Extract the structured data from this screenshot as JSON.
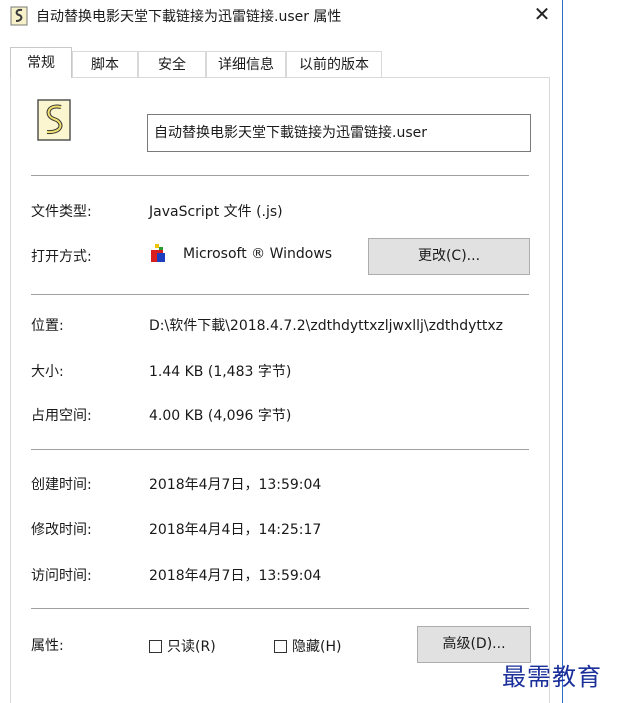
{
  "window": {
    "title": "自动替换电影天堂下載链接为迅雷链接.user 属性",
    "close_glyph": "✕"
  },
  "tabs": [
    {
      "label": "常规",
      "active": true
    },
    {
      "label": "脚本",
      "active": false
    },
    {
      "label": "安全",
      "active": false
    },
    {
      "label": "详细信息",
      "active": false
    },
    {
      "label": "以前的版本",
      "active": false
    }
  ],
  "general": {
    "file_name": "自动替换电影天堂下載链接为迅雷链接.user",
    "file_type_label": "文件类型:",
    "file_type_value": "JavaScript 文件 (.js)",
    "open_with_label": "打开方式:",
    "open_with_value": "Microsoft ® Windows",
    "change_button": "更改(C)...",
    "location_label": "位置:",
    "location_value": "D:\\软件下載\\2018.4.7.2\\zdthdyttxzljwxllj\\zdthdyttxz",
    "size_label": "大小:",
    "size_value": "1.44 KB (1,483 字节)",
    "size_on_disk_label": "占用空间:",
    "size_on_disk_value": "4.00 KB (4,096 字节)",
    "created_label": "创建时间:",
    "created_value": "2018年4月7日，13:59:04",
    "modified_label": "修改时间:",
    "modified_value": "2018年4月4日，14:25:17",
    "accessed_label": "访问时间:",
    "accessed_value": "2018年4月7日，13:59:04",
    "attributes_label": "属性:",
    "readonly_label": "只读(R)",
    "readonly_checked": false,
    "hidden_label": "隐藏(H)",
    "hidden_checked": false,
    "advanced_button": "高级(D)..."
  },
  "icons": {
    "title": "script-file-icon",
    "file": "script-file-icon",
    "app": "windows-script-host-icon"
  },
  "colors": {
    "accent_border": "#2b6fc6",
    "button_bg": "#e1e1e1",
    "watermark": "#1a2f9a"
  },
  "watermark": "最需教育"
}
